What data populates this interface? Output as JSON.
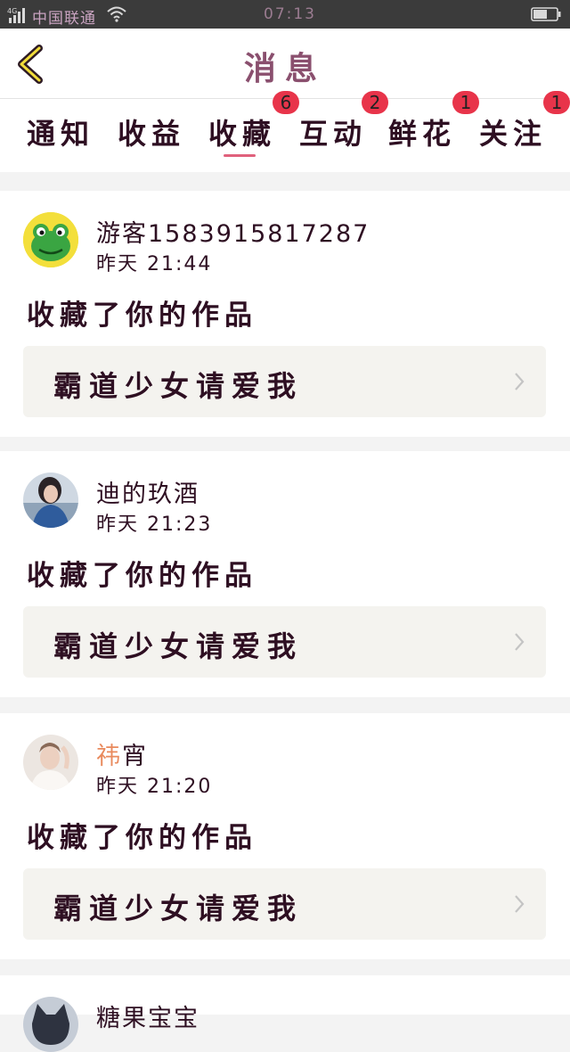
{
  "status_bar": {
    "network": "4G",
    "carrier": "中国联通",
    "time": "07:13"
  },
  "header": {
    "title": "消息"
  },
  "tabs": [
    {
      "label": "通知",
      "badge": ""
    },
    {
      "label": "收益",
      "badge": ""
    },
    {
      "label": "收藏",
      "badge": "6",
      "active": true
    },
    {
      "label": "互动",
      "badge": "2"
    },
    {
      "label": "鲜花",
      "badge": "1"
    },
    {
      "label": "关注",
      "badge": "1"
    }
  ],
  "messages": [
    {
      "user_prefix": "",
      "user_rest": "游客1583915817287",
      "time": "昨天 21:44",
      "action": "收藏了你的作品",
      "work_title": "霸道少女请爱我",
      "avatar": "frog-avatar"
    },
    {
      "user_prefix": "",
      "user_rest": "迪的玖酒",
      "time": "昨天 21:23",
      "action": "收藏了你的作品",
      "work_title": "霸道少女请爱我",
      "avatar": "photo-avatar"
    },
    {
      "user_prefix": "祎",
      "user_rest": "宵",
      "time": "昨天 21:20",
      "action": "收藏了你的作品",
      "work_title": "霸道少女请爱我",
      "avatar": "photo-avatar"
    },
    {
      "user_prefix": "",
      "user_rest": "糖果宝宝",
      "time": "",
      "action": "",
      "work_title": "",
      "avatar": "cat-avatar"
    }
  ],
  "colors": {
    "accent": "#e0617c",
    "badge": "#e8344a",
    "name_accent": "#e98a5d"
  }
}
